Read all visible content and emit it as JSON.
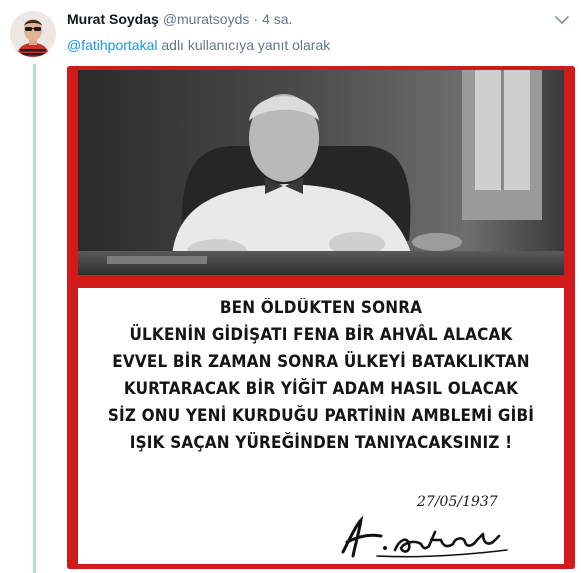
{
  "tweet": {
    "display_name": "Murat Soydaş",
    "screen_name": "@muratsoyds",
    "separator": "·",
    "time": "4 sa.",
    "reply_to_mention": "@fatihportakal",
    "reply_suffix": " adlı kullanıcıya yanıt olarak"
  },
  "media": {
    "quote_lines": [
      "BEN ÖLDÜKTEN SONRA",
      "ÜLKENİN GİDİŞATI FENA BİR AHVÂL ALACAK",
      "EVVEL BİR ZAMAN SONRA ÜLKEYİ BATAKLIKTAN",
      "KURTARACAK BİR YİĞİT ADAM HASIL OLACAK",
      "SİZ ONU YENİ KURDUĞU PARTİNİN AMBLEMİ GİBİ",
      "IŞIK SAÇAN YÜREĞİNDEN TANIYACAKSINIZ !"
    ],
    "date": "27/05/1937",
    "signature_text": "K. Atatürk"
  },
  "colors": {
    "frame_red": "#d11a1a",
    "link_blue": "#1b95e0",
    "thread_green": "#b6e2c4",
    "muted_gray": "#657786"
  },
  "icons": {
    "caret": "chevron-down-icon"
  }
}
